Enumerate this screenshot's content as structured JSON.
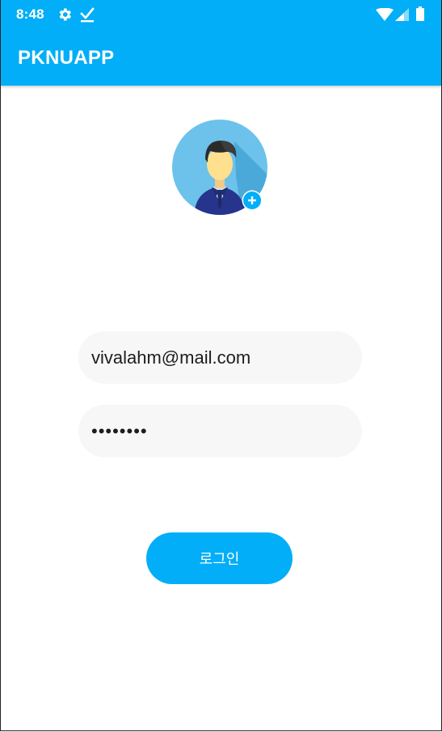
{
  "status_bar": {
    "time": "8:48",
    "icons": [
      "gear-icon",
      "download-done-icon",
      "wifi-icon",
      "cell-signal-icon",
      "battery-icon"
    ]
  },
  "app_bar": {
    "title": "PKNUAPP"
  },
  "profile": {
    "avatar_icon": "businessman-avatar-icon",
    "add_icon": "plus-icon"
  },
  "form": {
    "email_value": "vivalahm@mail.com",
    "password_value": "password"
  },
  "login_button": {
    "label": "로그인"
  },
  "colors": {
    "primary": "#02aef8",
    "field_background": "#f7f7f7",
    "text": "#1d1d1d",
    "white": "#ffffff"
  }
}
